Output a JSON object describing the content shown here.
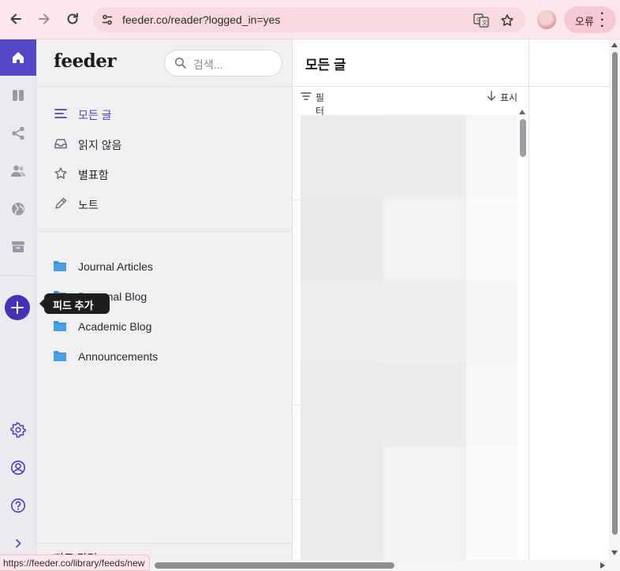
{
  "browser": {
    "url": "feeder.co/reader?logged_in=yes",
    "error_label": "오류",
    "status_url": "https://feeder.co/library/feeds/new",
    "icons": [
      "back-icon",
      "forward-icon",
      "reload-icon",
      "site-info-icon",
      "translate-icon",
      "bookmark-star-icon",
      "profile-avatar",
      "more-vert-icon"
    ]
  },
  "rail": {
    "tooltip": "피드 추가",
    "accent_color": "#5247c6"
  },
  "sidebar": {
    "logo": "feeder",
    "search_placeholder": "검색...",
    "nav": [
      {
        "label": "모든 글",
        "icon": "list-icon",
        "active": true
      },
      {
        "label": "읽지 않음",
        "icon": "inbox-icon",
        "active": false
      },
      {
        "label": "별표함",
        "icon": "star-icon",
        "active": false
      },
      {
        "label": "노트",
        "icon": "pencil-icon",
        "active": false
      }
    ],
    "folders": [
      {
        "label": "Journal Articles"
      },
      {
        "label": "Personal Blog"
      },
      {
        "label": "Academic Blog"
      },
      {
        "label": "Announcements"
      }
    ],
    "bottom_partial": "피드 관리"
  },
  "articles": {
    "title": "모든 글",
    "filter_label": "필터",
    "display_label": "표시"
  }
}
